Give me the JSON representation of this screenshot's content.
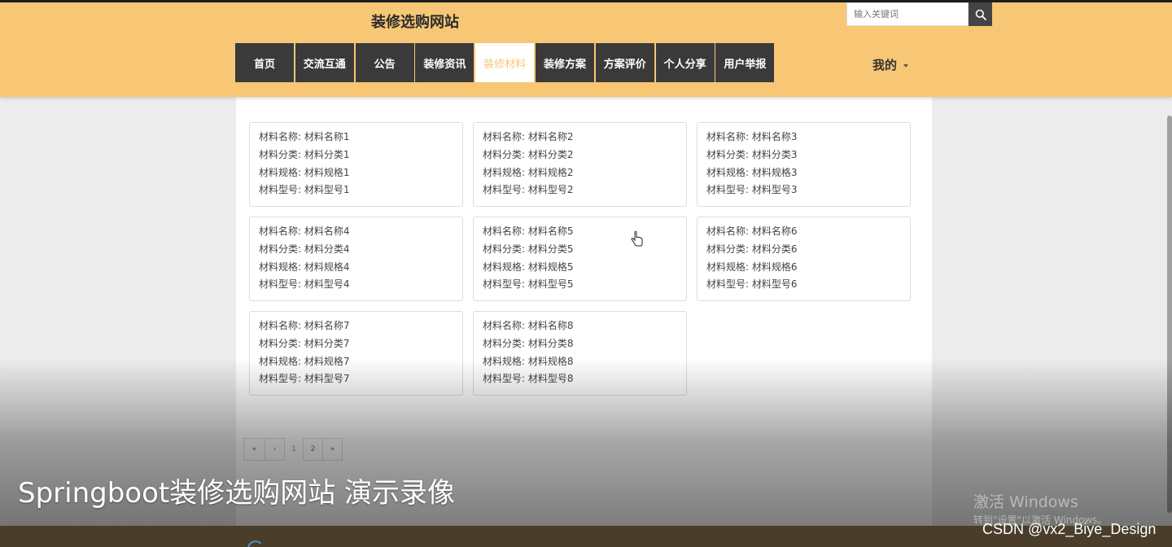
{
  "header": {
    "site_title": "装修选购网站",
    "search_placeholder": "输入关键词",
    "user_menu": "我的"
  },
  "nav": [
    {
      "label": "首页",
      "active": false
    },
    {
      "label": "交流互通",
      "active": false
    },
    {
      "label": "公告",
      "active": false
    },
    {
      "label": "装修资讯",
      "active": false
    },
    {
      "label": "装修材料",
      "active": true
    },
    {
      "label": "装修方案",
      "active": false
    },
    {
      "label": "方案评价",
      "active": false
    },
    {
      "label": "个人分享",
      "active": false
    },
    {
      "label": "用户举报",
      "active": false
    }
  ],
  "materials": [
    [
      "材料名称: 材料名称1",
      "材料分类: 材料分类1",
      "材料规格: 材料规格1",
      "材料型号: 材料型号1"
    ],
    [
      "材料名称: 材料名称2",
      "材料分类: 材料分类2",
      "材料规格: 材料规格2",
      "材料型号: 材料型号2"
    ],
    [
      "材料名称: 材料名称3",
      "材料分类: 材料分类3",
      "材料规格: 材料规格3",
      "材料型号: 材料型号3"
    ],
    [
      "材料名称: 材料名称4",
      "材料分类: 材料分类4",
      "材料规格: 材料规格4",
      "材料型号: 材料型号4"
    ],
    [
      "材料名称: 材料名称5",
      "材料分类: 材料分类5",
      "材料规格: 材料规格5",
      "材料型号: 材料型号5"
    ],
    [
      "材料名称: 材料名称6",
      "材料分类: 材料分类6",
      "材料规格: 材料规格6",
      "材料型号: 材料型号6"
    ],
    [
      "材料名称: 材料名称7",
      "材料分类: 材料分类7",
      "材料规格: 材料规格7",
      "材料型号: 材料型号7"
    ],
    [
      "材料名称: 材料名称8",
      "材料分类: 材料分类8",
      "材料规格: 材料规格8",
      "材料型号: 材料型号8"
    ]
  ],
  "pagination": {
    "first": "«",
    "prev": "‹",
    "current": "1",
    "next_page": "2",
    "last": "»"
  },
  "overlay": {
    "video_title": "Springboot装修选购网站 演示录像",
    "windows_activate": "激活 Windows",
    "windows_activate_hint": "转到\"设置\"以激活 Windows。",
    "csdn_credit": "CSDN @vx2_Biye_Design"
  },
  "colors": {
    "header_bg": "#f7c775",
    "nav_bg": "#3a3a3a",
    "active_text": "#f7c775"
  }
}
